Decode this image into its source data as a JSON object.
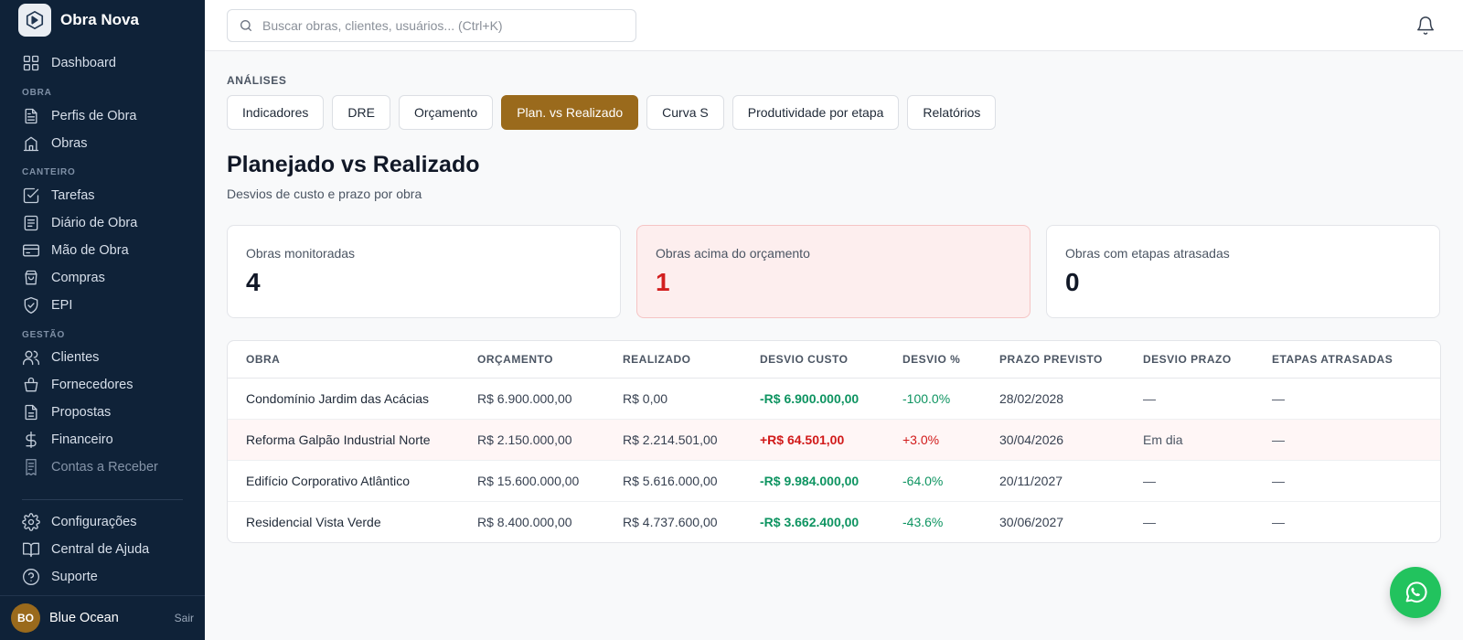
{
  "app": {
    "name": "Obra Nova"
  },
  "sidebar": {
    "items": [
      {
        "label": "Dashboard",
        "icon": "grid-icon"
      },
      {
        "label": "Perfis de Obra",
        "icon": "document-icon"
      },
      {
        "label": "Obras",
        "icon": "building-icon"
      },
      {
        "label": "Tarefas",
        "icon": "checkbox-icon"
      },
      {
        "label": "Diário de Obra",
        "icon": "notebook-icon"
      },
      {
        "label": "Mão de Obra",
        "icon": "id-card-icon"
      },
      {
        "label": "Compras",
        "icon": "shopping-bag-icon"
      },
      {
        "label": "EPI",
        "icon": "shield-check-icon"
      },
      {
        "label": "Clientes",
        "icon": "users-icon"
      },
      {
        "label": "Fornecedores",
        "icon": "basket-icon"
      },
      {
        "label": "Propostas",
        "icon": "file-text-icon"
      },
      {
        "label": "Financeiro",
        "icon": "dollar-icon"
      },
      {
        "label": "Contas a Receber",
        "icon": "receipt-icon"
      }
    ],
    "sections": [
      "OBRA",
      "CANTEIRO",
      "GESTÃO"
    ],
    "bottom_items": [
      {
        "label": "Configurações",
        "icon": "gear-icon"
      },
      {
        "label": "Central de Ajuda",
        "icon": "book-icon"
      },
      {
        "label": "Suporte",
        "icon": "help-circle-icon"
      }
    ],
    "user": {
      "initials": "BO",
      "name": "Blue Ocean",
      "logout": "Sair"
    }
  },
  "topbar": {
    "search_placeholder": "Buscar obras, clientes, usuários... (Ctrl+K)",
    "notification_icon": "bell-icon"
  },
  "main": {
    "eyebrow": "ANÁLISES",
    "tabs": [
      "Indicadores",
      "DRE",
      "Orçamento",
      "Plan. vs Realizado",
      "Curva S",
      "Produtividade por etapa",
      "Relatórios"
    ],
    "active_tab": "Plan. vs Realizado",
    "title": "Planejado vs Realizado",
    "subtitle": "Desvios de custo e prazo por obra",
    "cards": [
      {
        "label": "Obras monitoradas",
        "value": "4"
      },
      {
        "label": "Obras acima do orçamento",
        "value": "1"
      },
      {
        "label": "Obras com etapas atrasadas",
        "value": "0"
      }
    ],
    "table": {
      "headers": [
        "OBRA",
        "ORÇAMENTO",
        "REALIZADO",
        "DESVIO CUSTO",
        "DESVIO %",
        "PRAZO PREVISTO",
        "DESVIO PRAZO",
        "ETAPAS ATRASADAS"
      ],
      "rows": [
        [
          "Condomínio Jardim das Acácias",
          "R$ 6.900.000,00",
          "R$ 0,00",
          "-R$ 6.900.000,00",
          "-100.0%",
          "28/02/2028",
          "—",
          "—"
        ],
        [
          "Reforma Galpão Industrial Norte",
          "R$ 2.150.000,00",
          "R$ 2.214.501,00",
          "+R$ 64.501,00",
          "+3.0%",
          "30/04/2026",
          "Em dia",
          "—"
        ],
        [
          "Edifício Corporativo Atlântico",
          "R$ 15.600.000,00",
          "R$ 5.616.000,00",
          "-R$ 9.984.000,00",
          "-64.0%",
          "20/11/2027",
          "—",
          "—"
        ],
        [
          "Residencial Vista Verde",
          "R$ 8.400.000,00",
          "R$ 4.737.600,00",
          "-R$ 3.662.400,00",
          "-43.6%",
          "30/06/2027",
          "—",
          "—"
        ]
      ]
    }
  },
  "colors": {
    "sidebar_bg": "#0f2238",
    "accent": "#9a6a1c",
    "negative_deviation": "#0e9461",
    "positive_deviation": "#d11a1a",
    "whatsapp": "#22c35e"
  },
  "floating_button": {
    "icon": "whatsapp-icon"
  }
}
